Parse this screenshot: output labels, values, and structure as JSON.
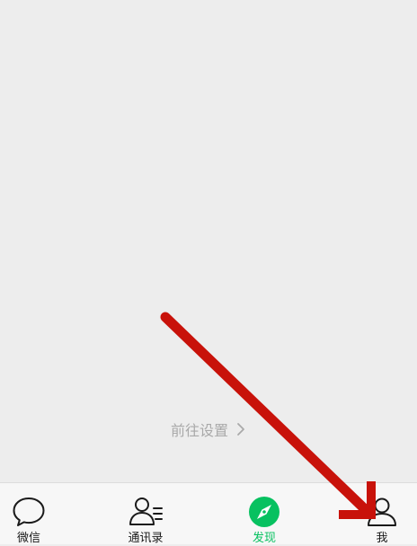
{
  "settings_link": {
    "label": "前往设置",
    "chevron_icon": "chevron-right-icon"
  },
  "tabbar": {
    "active_color": "#07c160",
    "tabs": [
      {
        "id": "chats",
        "label": "微信",
        "icon": "chat-bubble-icon",
        "active": false
      },
      {
        "id": "contacts",
        "label": "通讯录",
        "icon": "contacts-icon",
        "active": false
      },
      {
        "id": "discover",
        "label": "发现",
        "icon": "compass-icon",
        "active": true
      },
      {
        "id": "me",
        "label": "我",
        "icon": "person-icon",
        "active": false
      }
    ]
  },
  "annotation": {
    "arrow_color": "#c8120a",
    "arrow_icon": "red-arrow-icon"
  }
}
